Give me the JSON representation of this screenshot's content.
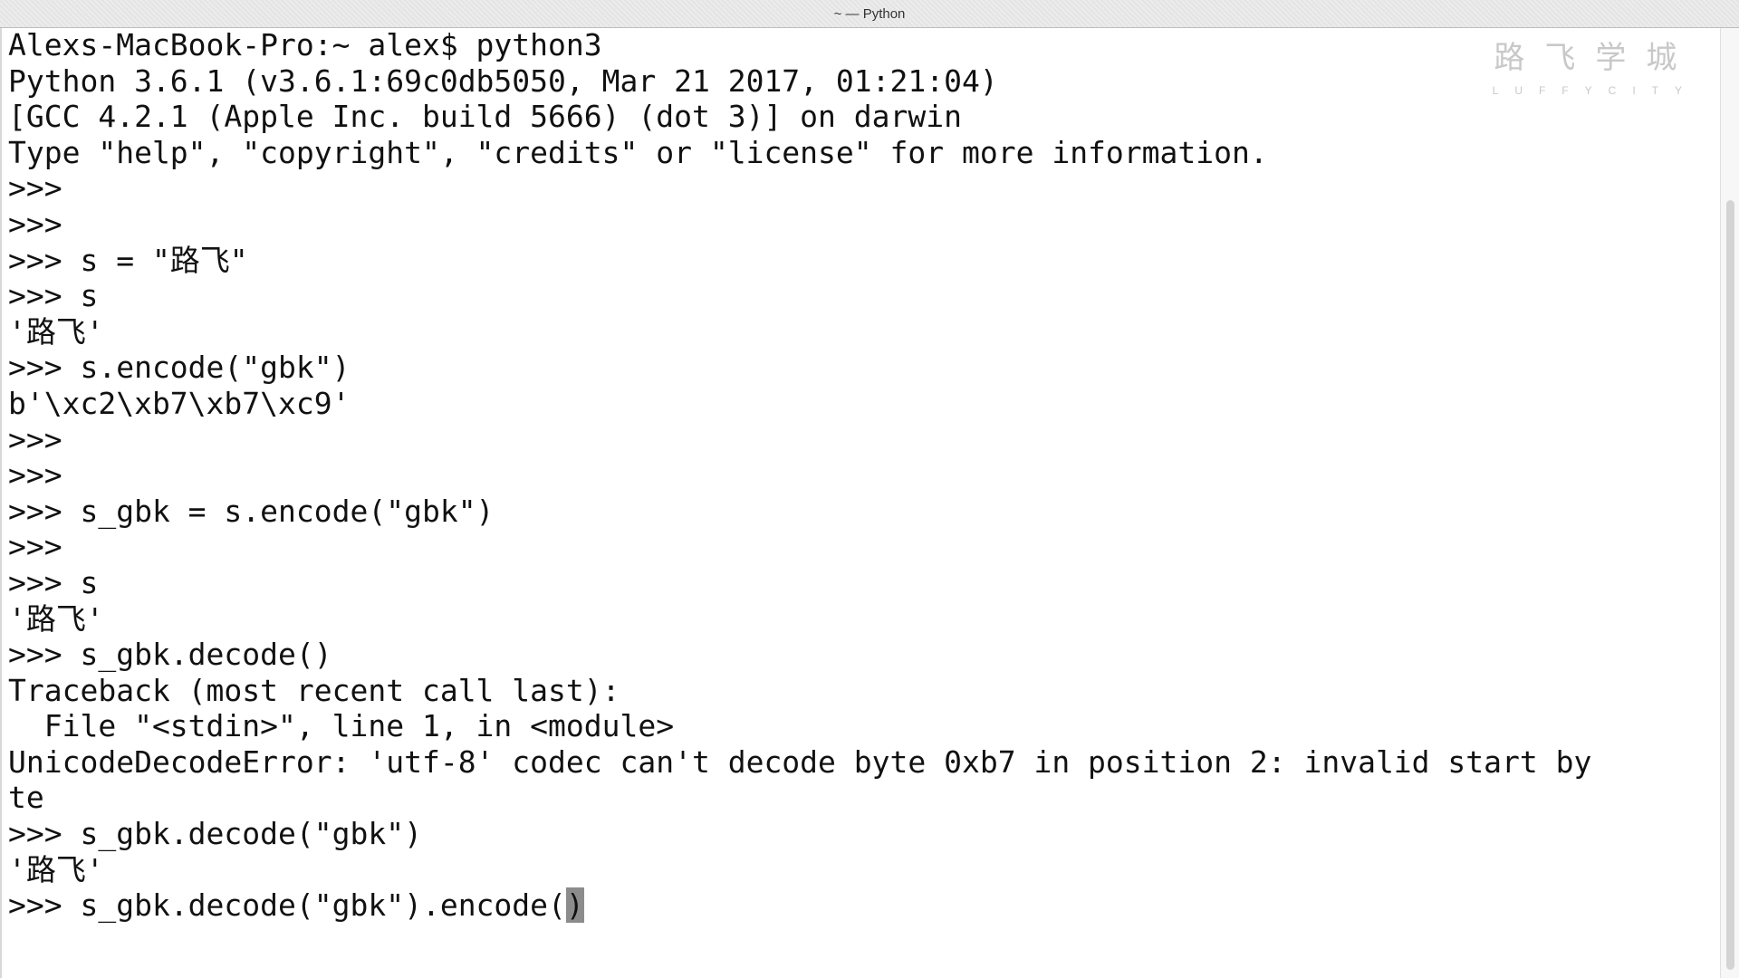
{
  "window": {
    "title": "~ — Python"
  },
  "watermark": {
    "chinese": "路飞学城",
    "english": "LUFFYCITY"
  },
  "terminal": {
    "lines": [
      "Alexs-MacBook-Pro:~ alex$ python3",
      "Python 3.6.1 (v3.6.1:69c0db5050, Mar 21 2017, 01:21:04)",
      "[GCC 4.2.1 (Apple Inc. build 5666) (dot 3)] on darwin",
      "Type \"help\", \"copyright\", \"credits\" or \"license\" for more information.",
      ">>>",
      ">>>",
      ">>> s = \"路飞\"",
      ">>> s",
      "'路飞'",
      ">>> s.encode(\"gbk\")",
      "b'\\xc2\\xb7\\xb7\\xc9'",
      ">>>",
      ">>>",
      ">>> s_gbk = s.encode(\"gbk\")",
      ">>>",
      ">>> s",
      "'路飞'",
      ">>> s_gbk.decode()",
      "Traceback (most recent call last):",
      "  File \"<stdin>\", line 1, in <module>",
      "UnicodeDecodeError: 'utf-8' codec can't decode byte 0xb7 in position 2: invalid start by",
      "te",
      ">>> s_gbk.decode(\"gbk\")",
      "'路飞'"
    ],
    "current_input": ">>> s_gbk.decode(\"gbk\").encode(",
    "cursor_char": ")"
  }
}
